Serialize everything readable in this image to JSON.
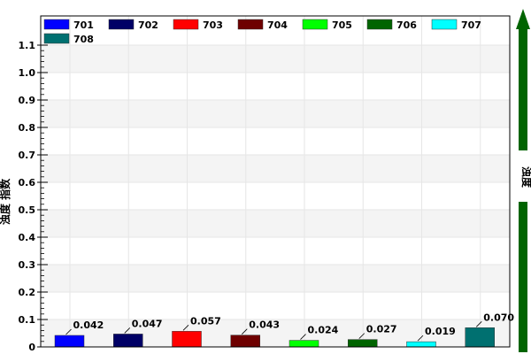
{
  "chart_data": {
    "type": "bar",
    "ylabel": "浊度 指数",
    "ylim": [
      0,
      1.1
    ],
    "yticks": [
      "0",
      "0.1",
      "0.2",
      "0.3",
      "0.4",
      "0.5",
      "0.6",
      "0.7",
      "0.8",
      "0.9",
      "1.0",
      "1.1"
    ],
    "grid": true,
    "legend_position": "top",
    "series": [
      {
        "name": "701",
        "value": 0.042,
        "label": "0.042",
        "color": "#0000FF"
      },
      {
        "name": "702",
        "value": 0.047,
        "label": "0.047",
        "color": "#000066"
      },
      {
        "name": "703",
        "value": 0.057,
        "label": "0.057",
        "color": "#FF0000"
      },
      {
        "name": "704",
        "value": 0.043,
        "label": "0.043",
        "color": "#6E0000"
      },
      {
        "name": "705",
        "value": 0.024,
        "label": "0.024",
        "color": "#00FF00"
      },
      {
        "name": "706",
        "value": 0.027,
        "label": "0.027",
        "color": "#006400"
      },
      {
        "name": "707",
        "value": 0.019,
        "label": "0.019",
        "color": "#00FFFF"
      },
      {
        "name": "708",
        "value": 0.07,
        "label": "0.070",
        "color": "#007070"
      }
    ]
  },
  "side_indicator": {
    "label": "浊度",
    "color": "#006400"
  }
}
